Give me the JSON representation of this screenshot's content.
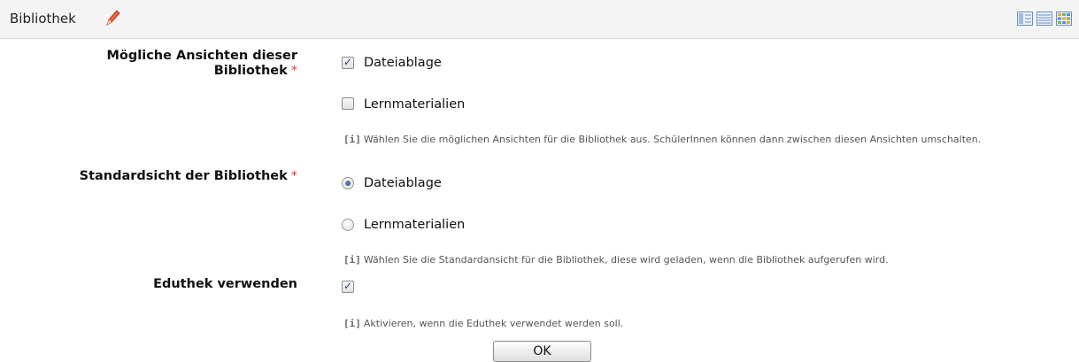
{
  "header": {
    "title": "Bibliothek",
    "edit_icon": "pencil-icon",
    "view_icons": [
      "detail-view-icon",
      "list-view-icon",
      "grid-view-icon"
    ]
  },
  "form": {
    "views": {
      "label_line1": "Mögliche Ansichten dieser",
      "label_line2": "Bibliothek",
      "required_marker": "*",
      "options": [
        {
          "label": "Dateiablage",
          "checked": true
        },
        {
          "label": "Lernmaterialien",
          "checked": false
        }
      ],
      "hint_icon": "[i]",
      "hint": "Wählen Sie die möglichen Ansichten für die Bibliothek aus. SchülerInnen können dann zwischen diesen Ansichten umschalten."
    },
    "default_view": {
      "label": "Standardsicht der Bibliothek",
      "required_marker": "*",
      "options": [
        {
          "label": "Dateiablage",
          "selected": true
        },
        {
          "label": "Lernmaterialien",
          "selected": false
        }
      ],
      "hint_icon": "[i]",
      "hint": "Wählen Sie die Standardansicht für die Bibliothek, diese wird geladen, wenn die Bibliothek aufgerufen wird."
    },
    "eduthek": {
      "label": "Eduthek verwenden",
      "checked": true,
      "hint_icon": "[i]",
      "hint": "Aktivieren, wenn die Eduthek verwendet werden soll."
    },
    "ok_label": "OK"
  },
  "colors": {
    "required": "#d0413a",
    "header_bg": "#f4f4f4",
    "hint_text": "#555555"
  }
}
